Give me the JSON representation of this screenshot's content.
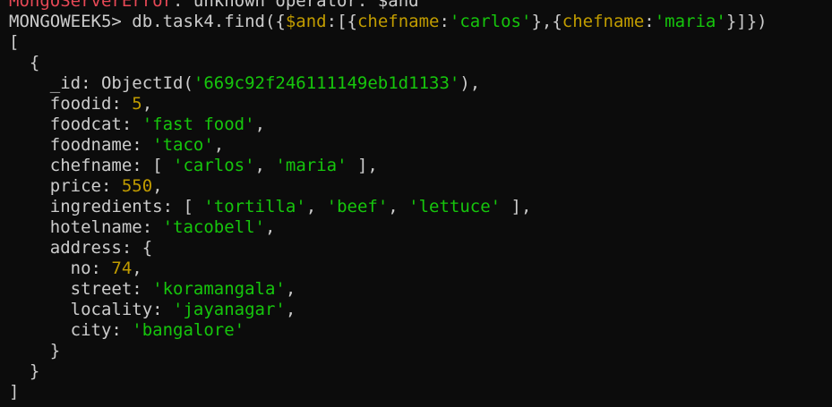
{
  "window": {
    "title": ""
  },
  "colors": {
    "background": "#0c0c0c",
    "text": "#cccccc",
    "error": "#e74856",
    "string": "#16c60c",
    "number": "#c19c00"
  },
  "terminal": {
    "lines": [
      [
        {
          "t": "MongoServerError",
          "c": "err"
        },
        {
          "t": ": unknown operator: $and",
          "c": "txt"
        }
      ],
      [
        {
          "t": "MONGOWEEK5> db.task4.find({",
          "c": "txt"
        },
        {
          "t": "$and",
          "c": "op"
        },
        {
          "t": ":[{",
          "c": "txt"
        },
        {
          "t": "chefname",
          "c": "key"
        },
        {
          "t": ":",
          "c": "txt"
        },
        {
          "t": "'carlos'",
          "c": "str"
        },
        {
          "t": "},{",
          "c": "txt"
        },
        {
          "t": "chefname",
          "c": "key"
        },
        {
          "t": ":",
          "c": "txt"
        },
        {
          "t": "'maria'",
          "c": "str"
        },
        {
          "t": "}]})",
          "c": "txt"
        }
      ],
      [
        {
          "t": "[",
          "c": "txt"
        }
      ],
      [
        {
          "t": "  {",
          "c": "txt"
        }
      ],
      [
        {
          "t": "    _id: ObjectId(",
          "c": "txt"
        },
        {
          "t": "'669c92f246111149eb1d1133'",
          "c": "str"
        },
        {
          "t": "),",
          "c": "txt"
        }
      ],
      [
        {
          "t": "    foodid: ",
          "c": "txt"
        },
        {
          "t": "5",
          "c": "num"
        },
        {
          "t": ",",
          "c": "txt"
        }
      ],
      [
        {
          "t": "    foodcat: ",
          "c": "txt"
        },
        {
          "t": "'fast food'",
          "c": "str"
        },
        {
          "t": ",",
          "c": "txt"
        }
      ],
      [
        {
          "t": "    foodname: ",
          "c": "txt"
        },
        {
          "t": "'taco'",
          "c": "str"
        },
        {
          "t": ",",
          "c": "txt"
        }
      ],
      [
        {
          "t": "    chefname: [ ",
          "c": "txt"
        },
        {
          "t": "'carlos'",
          "c": "str"
        },
        {
          "t": ", ",
          "c": "txt"
        },
        {
          "t": "'maria'",
          "c": "str"
        },
        {
          "t": " ],",
          "c": "txt"
        }
      ],
      [
        {
          "t": "    price: ",
          "c": "txt"
        },
        {
          "t": "550",
          "c": "num"
        },
        {
          "t": ",",
          "c": "txt"
        }
      ],
      [
        {
          "t": "    ingredients: [ ",
          "c": "txt"
        },
        {
          "t": "'tortilla'",
          "c": "str"
        },
        {
          "t": ", ",
          "c": "txt"
        },
        {
          "t": "'beef'",
          "c": "str"
        },
        {
          "t": ", ",
          "c": "txt"
        },
        {
          "t": "'lettuce'",
          "c": "str"
        },
        {
          "t": " ],",
          "c": "txt"
        }
      ],
      [
        {
          "t": "    hotelname: ",
          "c": "txt"
        },
        {
          "t": "'tacobell'",
          "c": "str"
        },
        {
          "t": ",",
          "c": "txt"
        }
      ],
      [
        {
          "t": "    address: {",
          "c": "txt"
        }
      ],
      [
        {
          "t": "      no: ",
          "c": "txt"
        },
        {
          "t": "74",
          "c": "num"
        },
        {
          "t": ",",
          "c": "txt"
        }
      ],
      [
        {
          "t": "      street: ",
          "c": "txt"
        },
        {
          "t": "'koramangala'",
          "c": "str"
        },
        {
          "t": ",",
          "c": "txt"
        }
      ],
      [
        {
          "t": "      locality: ",
          "c": "txt"
        },
        {
          "t": "'jayanagar'",
          "c": "str"
        },
        {
          "t": ",",
          "c": "txt"
        }
      ],
      [
        {
          "t": "      city: ",
          "c": "txt"
        },
        {
          "t": "'bangalore'",
          "c": "str"
        }
      ],
      [
        {
          "t": "    }",
          "c": "txt"
        }
      ],
      [
        {
          "t": "  }",
          "c": "txt"
        }
      ],
      [
        {
          "t": "]",
          "c": "txt"
        }
      ]
    ]
  }
}
